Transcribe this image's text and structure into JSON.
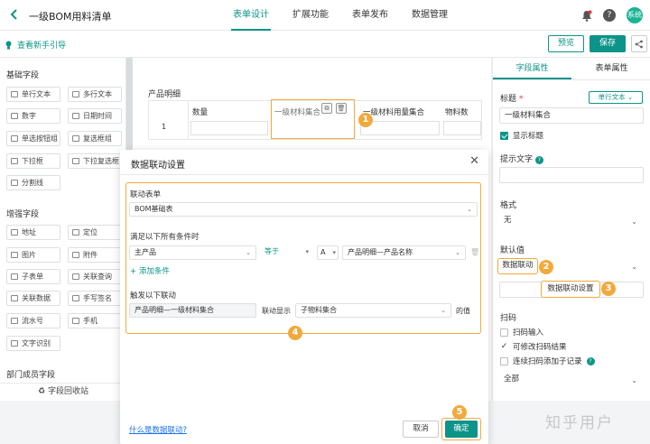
{
  "header": {
    "title": "一级BOM用料清单",
    "nav": [
      "表单设计",
      "扩展功能",
      "表单发布",
      "数据管理"
    ],
    "avatar_text": "系统"
  },
  "subbar": {
    "guide": "查看新手引导",
    "preview": "预览",
    "save": "保存"
  },
  "left": {
    "basic_title": "基础字段",
    "basic": [
      "单行文本",
      "多行文本",
      "数字",
      "日期时间",
      "单选按钮组",
      "复选框组",
      "下拉框",
      "下拉复选框",
      "分割线"
    ],
    "enhanced_title": "增强字段",
    "enhanced": [
      "地址",
      "定位",
      "图片",
      "附件",
      "子表单",
      "关联查询",
      "关联数据",
      "手写签名",
      "流水号",
      "手机",
      "文字识别"
    ],
    "dept_title": "部门成员字段",
    "recycle": "字段回收站"
  },
  "canvas": {
    "table_title": "产品明细",
    "columns": [
      "数量",
      "一级材料集合",
      "一级材料用量集合",
      "物料数"
    ],
    "row_number": "1"
  },
  "right": {
    "tabs": [
      "字段属性",
      "表单属性"
    ],
    "title_label": "标题",
    "required_mark": "*",
    "type_badge": "单行文本",
    "title_value": "一级材料集合",
    "show_title": "显示标题",
    "hint_label": "提示文字",
    "format_label": "格式",
    "format_value": "无",
    "default_label": "默认值",
    "default_value": "数据联动",
    "linkage_btn": "数据联动设置",
    "scan_label": "扫码",
    "scan_input": "扫码输入",
    "scan_edit": "可修改扫码结果",
    "scan_continuous": "连续扫码添加子记录",
    "scope_value": "全部"
  },
  "modal": {
    "title": "数据联动设置",
    "link_form_label": "联动表单",
    "link_form_value": "BOM基础表",
    "condition_label": "满足以下所有条件时",
    "cond_field": "主产品",
    "cond_op": "等于",
    "cond_type": "A",
    "cond_value": "产品明细—产品名称",
    "add_condition": "添加条件",
    "trigger_label": "触发以下联动",
    "trigger_target": "产品明细—一级材料集合",
    "trigger_mid": "联动显示",
    "trigger_source": "子物料集合",
    "trigger_suffix": "的值",
    "help_link": "什么是数据联动?",
    "cancel": "取消",
    "ok": "确定"
  },
  "badges": [
    "1",
    "2",
    "3",
    "4",
    "5"
  ],
  "watermark": "知乎用户",
  "colors": {
    "accent": "#0d9488",
    "highlight": "#f2a93b"
  }
}
